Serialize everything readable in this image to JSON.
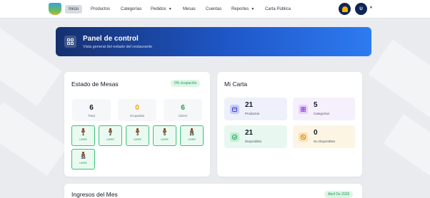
{
  "navbar": {
    "items": [
      {
        "label": "Inicio",
        "active": true
      },
      {
        "label": "Productos"
      },
      {
        "label": "Categorías"
      },
      {
        "label": "Pedidos",
        "caret": true
      },
      {
        "label": "Mesas"
      },
      {
        "label": "Cuentas"
      },
      {
        "label": "Reportes",
        "caret": true
      },
      {
        "label": "Carta Pública"
      }
    ],
    "bell_icon": "bell-icon",
    "user_initial": "U",
    "bell_color": "#f4b400",
    "nav_bg": "#0f2557"
  },
  "header": {
    "title": "Panel de control",
    "subtitle": "Vista general del estado del restaurante",
    "icon": "grid-icon"
  },
  "mesas": {
    "title": "Estado de Mesas",
    "occupancy_badge": "0% ocupación",
    "stats": [
      {
        "value": "6",
        "label": "Total",
        "color": "#111827"
      },
      {
        "value": "0",
        "label": "Ocupadas",
        "color": "#f59e0b"
      },
      {
        "value": "6",
        "label": "Libres",
        "color": "#16a34a"
      }
    ],
    "tables": [
      {
        "number": "1",
        "status": "LIBRE"
      },
      {
        "number": "2",
        "status": "LIBRE"
      },
      {
        "number": "3",
        "status": "LIBRE"
      },
      {
        "number": "5",
        "status": "LIBRE"
      },
      {
        "number": "25",
        "status": "LIBRE"
      },
      {
        "number": "30",
        "status": "LIBRE"
      }
    ]
  },
  "carta": {
    "title": "Mi Carta",
    "cards": [
      {
        "value": "21",
        "label": "Productos",
        "icon": "calendar-icon",
        "bg": "#eef0fb",
        "icon_bg": "#c7cdf3",
        "icon_fg": "#4f46e5"
      },
      {
        "value": "5",
        "label": "Categorías",
        "icon": "grid-icon",
        "bg": "#f6effc",
        "icon_bg": "#e4d2f7",
        "icon_fg": "#9333ea"
      },
      {
        "value": "21",
        "label": "Disponibles",
        "icon": "check-circle-icon",
        "bg": "#e8f7ef",
        "icon_bg": "#c4ecd6",
        "icon_fg": "#16a34a"
      },
      {
        "value": "0",
        "label": "No Disponibles",
        "icon": "ban-icon",
        "bg": "#fdf5e4",
        "icon_bg": "#f8e2b3",
        "icon_fg": "#d97706"
      }
    ]
  },
  "ingresos": {
    "title": "Ingresos del Mes",
    "date_badge": "Abril De 2026"
  }
}
